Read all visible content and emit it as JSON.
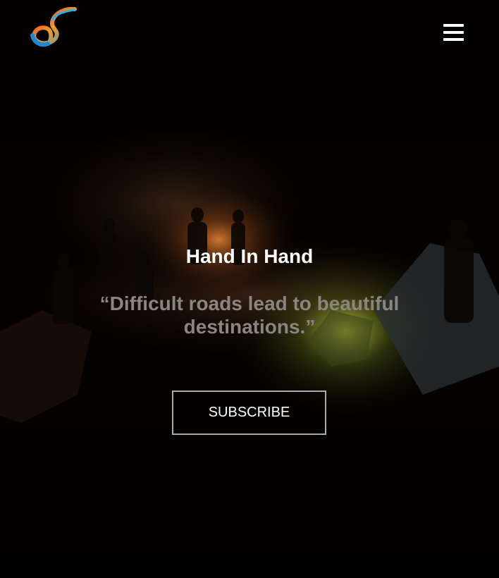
{
  "header": {
    "logo_icon": "infinity-swirl-logo-icon",
    "menu_icon": "hamburger-menu-icon"
  },
  "hero": {
    "title": "Hand In Hand",
    "quote": "“Difficult roads lead to beautiful destinations.”",
    "subscribe_label": "SUBSCRIBE",
    "background_description_colors": {
      "base": "#040201",
      "firelight": "#b8632a",
      "tent_glow": "#c8d23a"
    }
  }
}
